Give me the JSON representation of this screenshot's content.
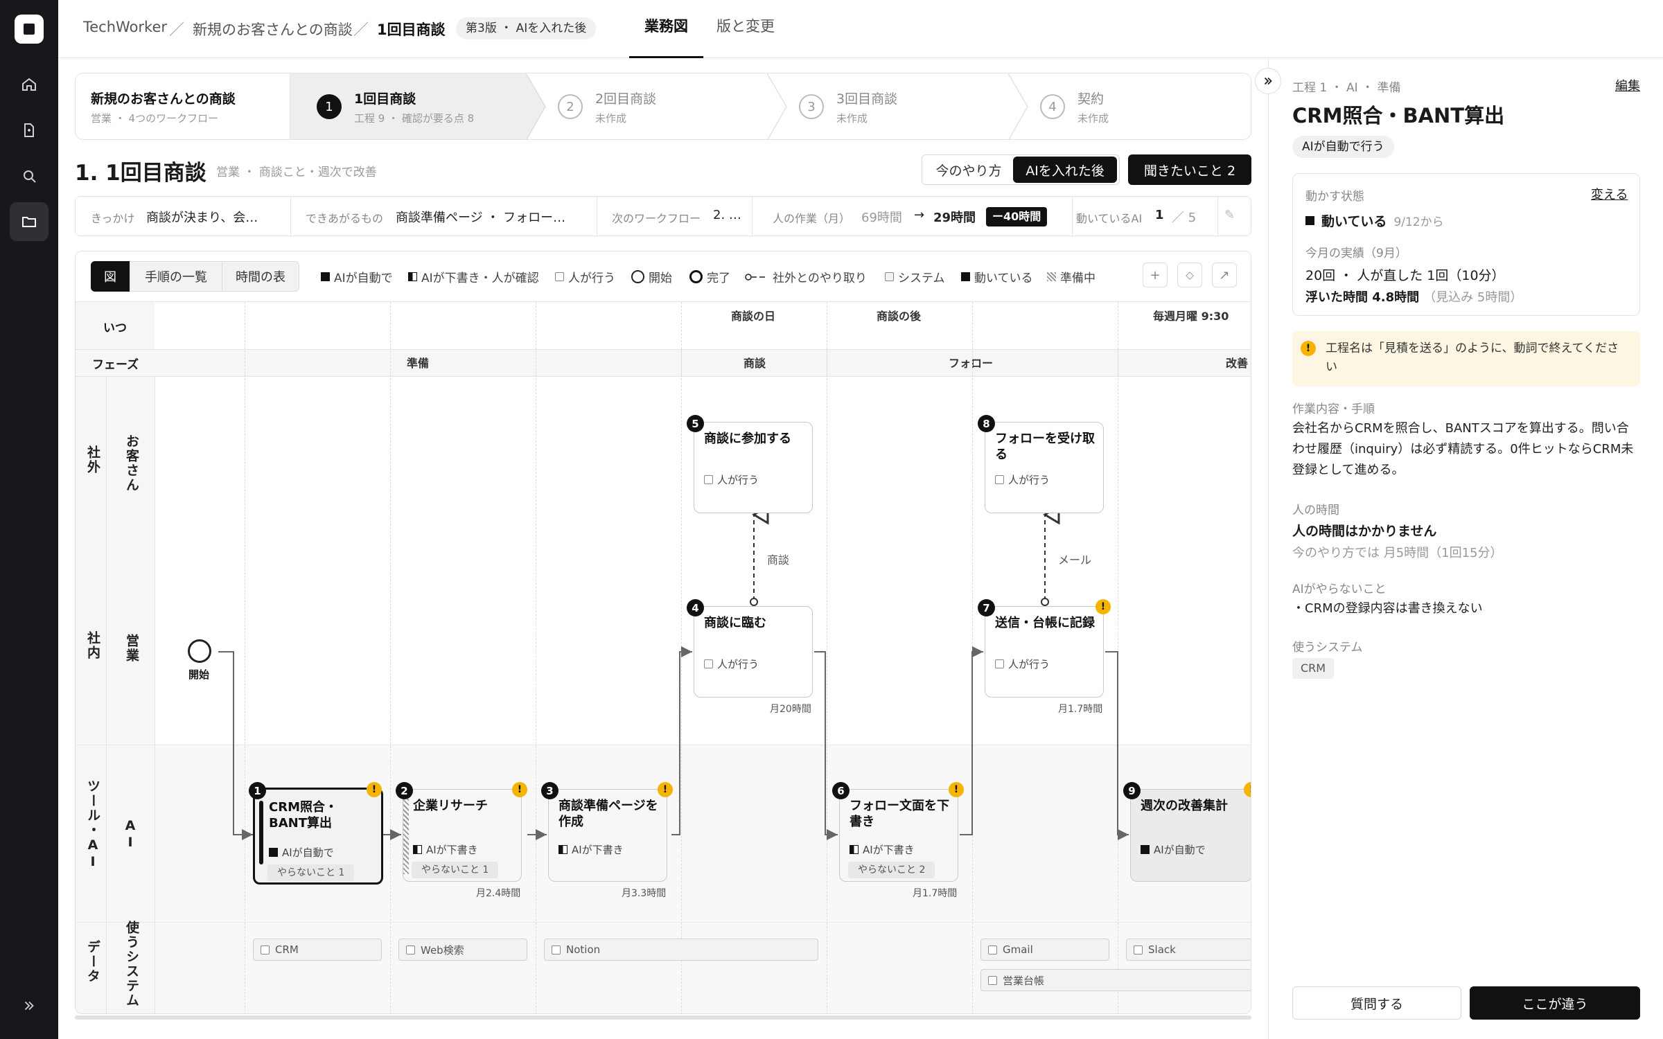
{
  "topbar": {
    "crumb1": "TechWorker",
    "crumb2": "新規のお客さんとの商談",
    "crumb3": "1回目商談",
    "version": "第3版 ・ AIを入れた後",
    "tab1": "業務図",
    "tab2": "版と変更",
    "sep": "／"
  },
  "stepper": {
    "root_title": "新規のお客さんとの商談",
    "root_sub": "営業 ・ 4つのワークフロー",
    "steps": [
      {
        "num": "1",
        "title": "1回目商談",
        "sub": "工程 9 ・ 確認が要る点 8"
      },
      {
        "num": "2",
        "title": "2回目商談",
        "sub": "未作成"
      },
      {
        "num": "3",
        "title": "3回目商談",
        "sub": "未作成"
      },
      {
        "num": "4",
        "title": "契約",
        "sub": "未作成"
      }
    ]
  },
  "page": {
    "title": "1. 1回目商談",
    "meta": "営業 ・ 商談こと・週次で改善",
    "btn_now": "今のやり方",
    "btn_after": "AIを入れた後",
    "btn_ask": "聞きたいこと 2"
  },
  "strip": {
    "l1": "きっかけ",
    "v1": "商談が決まり、会…",
    "l2": "できあがるもの",
    "v2": "商談準備ページ ・ フォロー…",
    "l3": "次のワークフロー",
    "v3": "2. …",
    "l4": "人の作業（月）",
    "v4a": "69時間",
    "arrow": "→",
    "v4b": "29時間",
    "v4c": "ー40時間",
    "l5": "動いているAI",
    "v5a": "1",
    "v5b": "／ 5",
    "edit": "✎"
  },
  "view": {
    "tab1": "図",
    "tab2": "手順の一覧",
    "tab3": "時間の表"
  },
  "legend": [
    "AIが自動で",
    "AIが下書き・人が確認",
    "人が行う",
    "開始",
    "完了",
    "社外とのやり取り",
    "システム",
    "動いている",
    "準備中"
  ],
  "tools": {
    "plus": "+",
    "diamond": "◇",
    "expand": "↗"
  },
  "diagram": {
    "row_when": "いつ",
    "row_phase": "フェーズ",
    "when": {
      "c1": "商談の日",
      "c2": "商談の後",
      "c3": "毎週月曜 9:30"
    },
    "phases": {
      "p1": "準備",
      "p2": "商談",
      "p3": "フォロー",
      "p4": "改善"
    },
    "lanes": {
      "g1": "社外",
      "l1": "お客さん",
      "g2": "社内",
      "l2": "営業",
      "g3": "ツール・AI",
      "l3": "AI",
      "g4": "データ",
      "l4": "使うシステム"
    },
    "start": "開始",
    "edges": {
      "e1": "商談",
      "e2": "メール"
    },
    "nodes": [
      {
        "num": "1",
        "name": "CRM照合・BANT算出",
        "tag": "AIが自動で",
        "dont": "やらないこと 1",
        "time": ""
      },
      {
        "num": "2",
        "name": "企業リサーチ",
        "tag": "AIが下書き",
        "dont": "やらないこと 1",
        "time": "月2.4時間"
      },
      {
        "num": "3",
        "name": "商談準備ページを作成",
        "tag": "AIが下書き",
        "dont": "",
        "time": "月3.3時間"
      },
      {
        "num": "4",
        "name": "商談に臨む",
        "tag": "人が行う",
        "dont": "",
        "time": "月20時間"
      },
      {
        "num": "5",
        "name": "商談に参加する",
        "tag": "人が行う",
        "dont": "",
        "time": ""
      },
      {
        "num": "6",
        "name": "フォロー文面を下書き",
        "tag": "AIが下書き",
        "dont": "やらないこと 2",
        "time": "月1.7時間"
      },
      {
        "num": "7",
        "name": "送信・台帳に記録",
        "tag": "人が行う",
        "dont": "",
        "time": "月1.7時間"
      },
      {
        "num": "8",
        "name": "フォローを受け取る",
        "tag": "人が行う",
        "dont": "",
        "time": ""
      },
      {
        "num": "9",
        "name": "週次の改善集計",
        "tag": "AIが自動で",
        "dont": "",
        "time": ""
      }
    ],
    "warn": "!",
    "systems": [
      "CRM",
      "Web検索",
      "Notion",
      "Gmail",
      "Slack",
      "営業台帳"
    ]
  },
  "panel": {
    "crumb": "工程 1 ・ AI ・ 準備",
    "edit": "編集",
    "title": "CRM照合・BANT算出",
    "mode": "AIが自動で行う",
    "state_label": "動かす状態",
    "change": "変える",
    "state": "動いている",
    "state_since": "9/12から",
    "month_label": "今月の実績（9月）",
    "month_line": "20回 ・ 人が直した 1回（10分）",
    "saved": "浮いた時間 4.8時間",
    "saved_est": "（見込み 5時間）",
    "warning": "工程名は「見積を送る」のように、動詞で終えてください",
    "content_label": "作業内容・手順",
    "content": "会社名からCRMを照合し、BANTスコアを算出する。問い合わせ履歴（inquiry）は必ず精読する。0件ヒットならCRM未登録として進める。",
    "human_label": "人の時間",
    "human": "人の時間はかかりません",
    "human_prev": "今のやり方では 月5時間（1回15分）",
    "ai_no_label": "AIがやらないこと",
    "ai_no": "・CRMの登録内容は書き換えない",
    "sys_label": "使うシステム",
    "sys": "CRM",
    "btn_q": "質問する",
    "btn_diff": "ここが違う"
  },
  "colors": {
    "accent": "#111111",
    "warn": "#f4b400",
    "warn_bg": "#fdf6e3"
  }
}
